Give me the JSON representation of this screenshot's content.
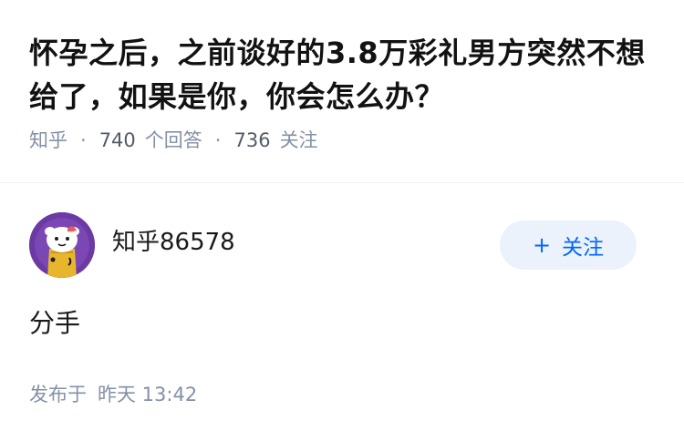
{
  "question": {
    "title": "怀孕之后，之前谈好的3.8万彩礼男方突然不想给了，如果是你，你会怎么办？",
    "source": "知乎",
    "answer_count": "740",
    "answer_label": "个回答",
    "follow_count": "736",
    "follow_label": "关注"
  },
  "author": {
    "name": "知乎86578",
    "avatar_icon": "cartoon-avatar",
    "follow_plus": "+",
    "follow_label": "关注"
  },
  "answer": {
    "text": "分手",
    "published_label": "发布于",
    "published_time": "昨天 13:42"
  },
  "colors": {
    "accent": "#0066ff",
    "follow_bg": "#ebf2fc",
    "meta_gray": "#8590a6",
    "avatar_bg": "#6b3aa3"
  }
}
